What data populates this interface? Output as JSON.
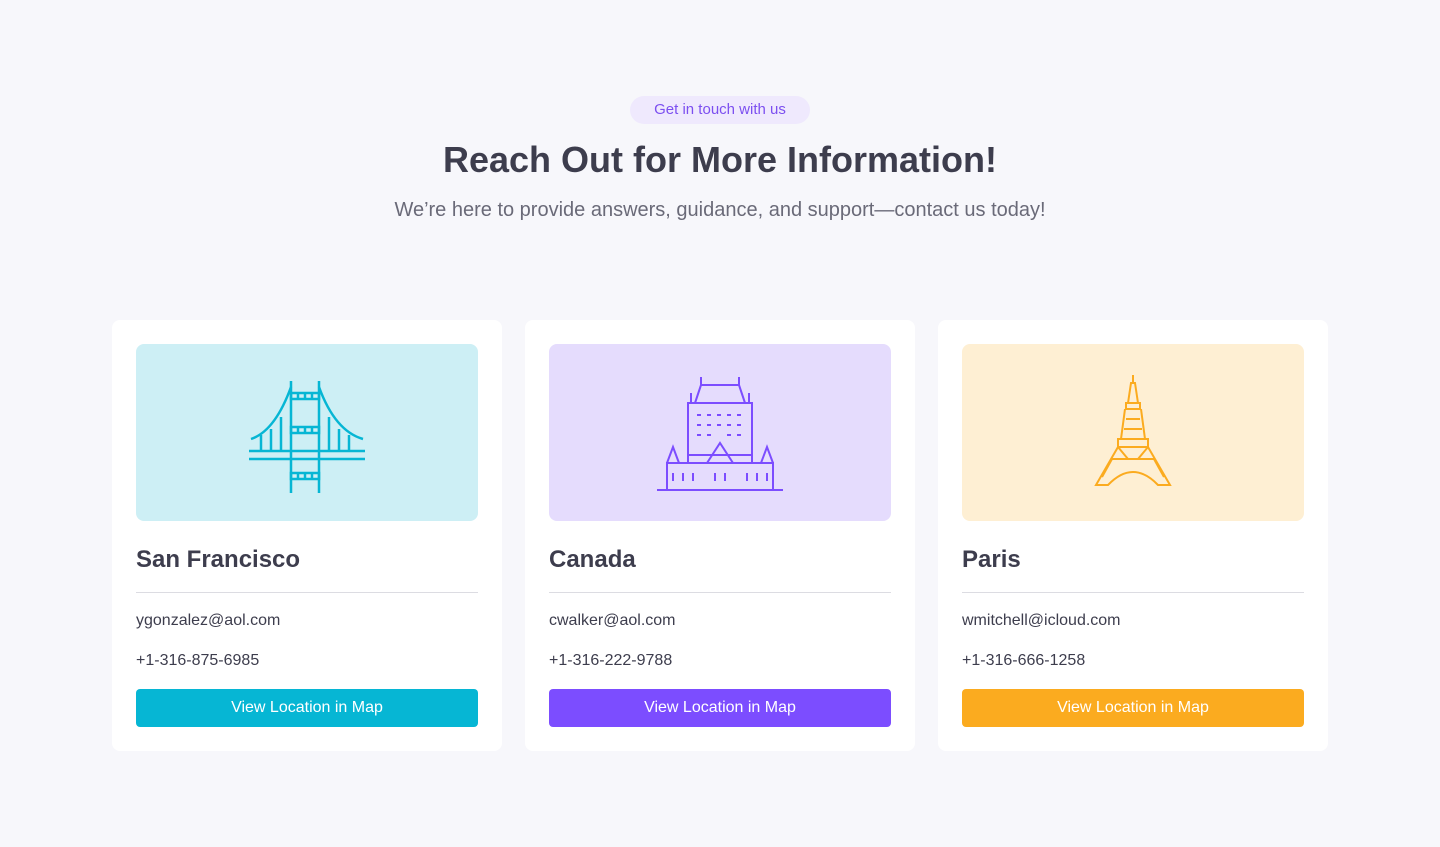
{
  "header": {
    "badge": "Get in touch with us",
    "title": "Reach Out for More Information!",
    "subtitle": "We’re here to provide answers, guidance, and support—contact us today!"
  },
  "locations": [
    {
      "city": "San Francisco",
      "email": "ygonzalez@aol.com",
      "phone": "+1-316-875-6985",
      "button_label": "View Location in Map",
      "icon": "golden-gate-bridge-icon",
      "accent": "#06b6d4",
      "tint": "#cdeff5"
    },
    {
      "city": "Canada",
      "email": "cwalker@aol.com",
      "phone": "+1-316-222-9788",
      "button_label": "View Location in Map",
      "icon": "chateau-frontenac-icon",
      "accent": "#7c4dff",
      "tint": "#e5dcfd"
    },
    {
      "city": "Paris",
      "email": "wmitchell@icloud.com",
      "phone": "+1-316-666-1258",
      "button_label": "View Location in Map",
      "icon": "eiffel-tower-icon",
      "accent": "#fbab1f",
      "tint": "#feefd3"
    }
  ]
}
